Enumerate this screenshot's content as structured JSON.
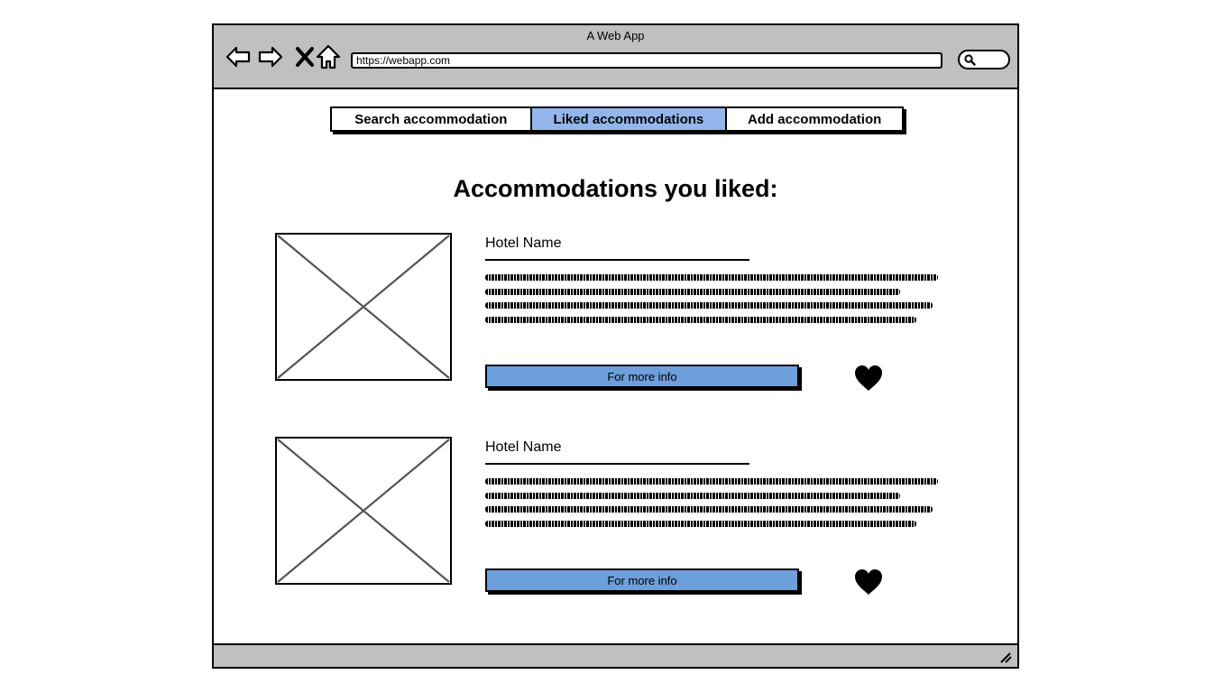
{
  "window": {
    "title": "A Web App"
  },
  "browser": {
    "url": "https://webapp.com"
  },
  "tabs": [
    {
      "label": "Search accommodation",
      "active": false
    },
    {
      "label": "Liked accommodations",
      "active": true
    },
    {
      "label": "Add accommodation",
      "active": false
    }
  ],
  "page": {
    "title": "Accommodations you liked:"
  },
  "cards": [
    {
      "name": "Hotel Name",
      "button": "For more info",
      "icon": "heart-icon",
      "image": "image-placeholder"
    },
    {
      "name": "Hotel Name",
      "button": "For more info",
      "icon": "heart-icon",
      "image": "image-placeholder"
    }
  ],
  "colors": {
    "active_tab": "#93b7ec",
    "button": "#6d9fdc",
    "chrome": "#c0c0c0"
  }
}
